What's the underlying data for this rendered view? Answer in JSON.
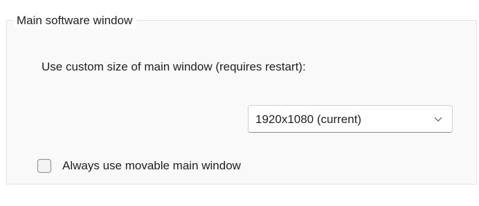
{
  "group": {
    "title": "Main software window"
  },
  "custom_size": {
    "label": "Use custom size of main window (requires restart):",
    "selected_value": "1920x1080 (current)",
    "chevron_icon": "chevron-down-icon"
  },
  "movable_window": {
    "label": "Always use movable main window",
    "checked": false
  }
}
